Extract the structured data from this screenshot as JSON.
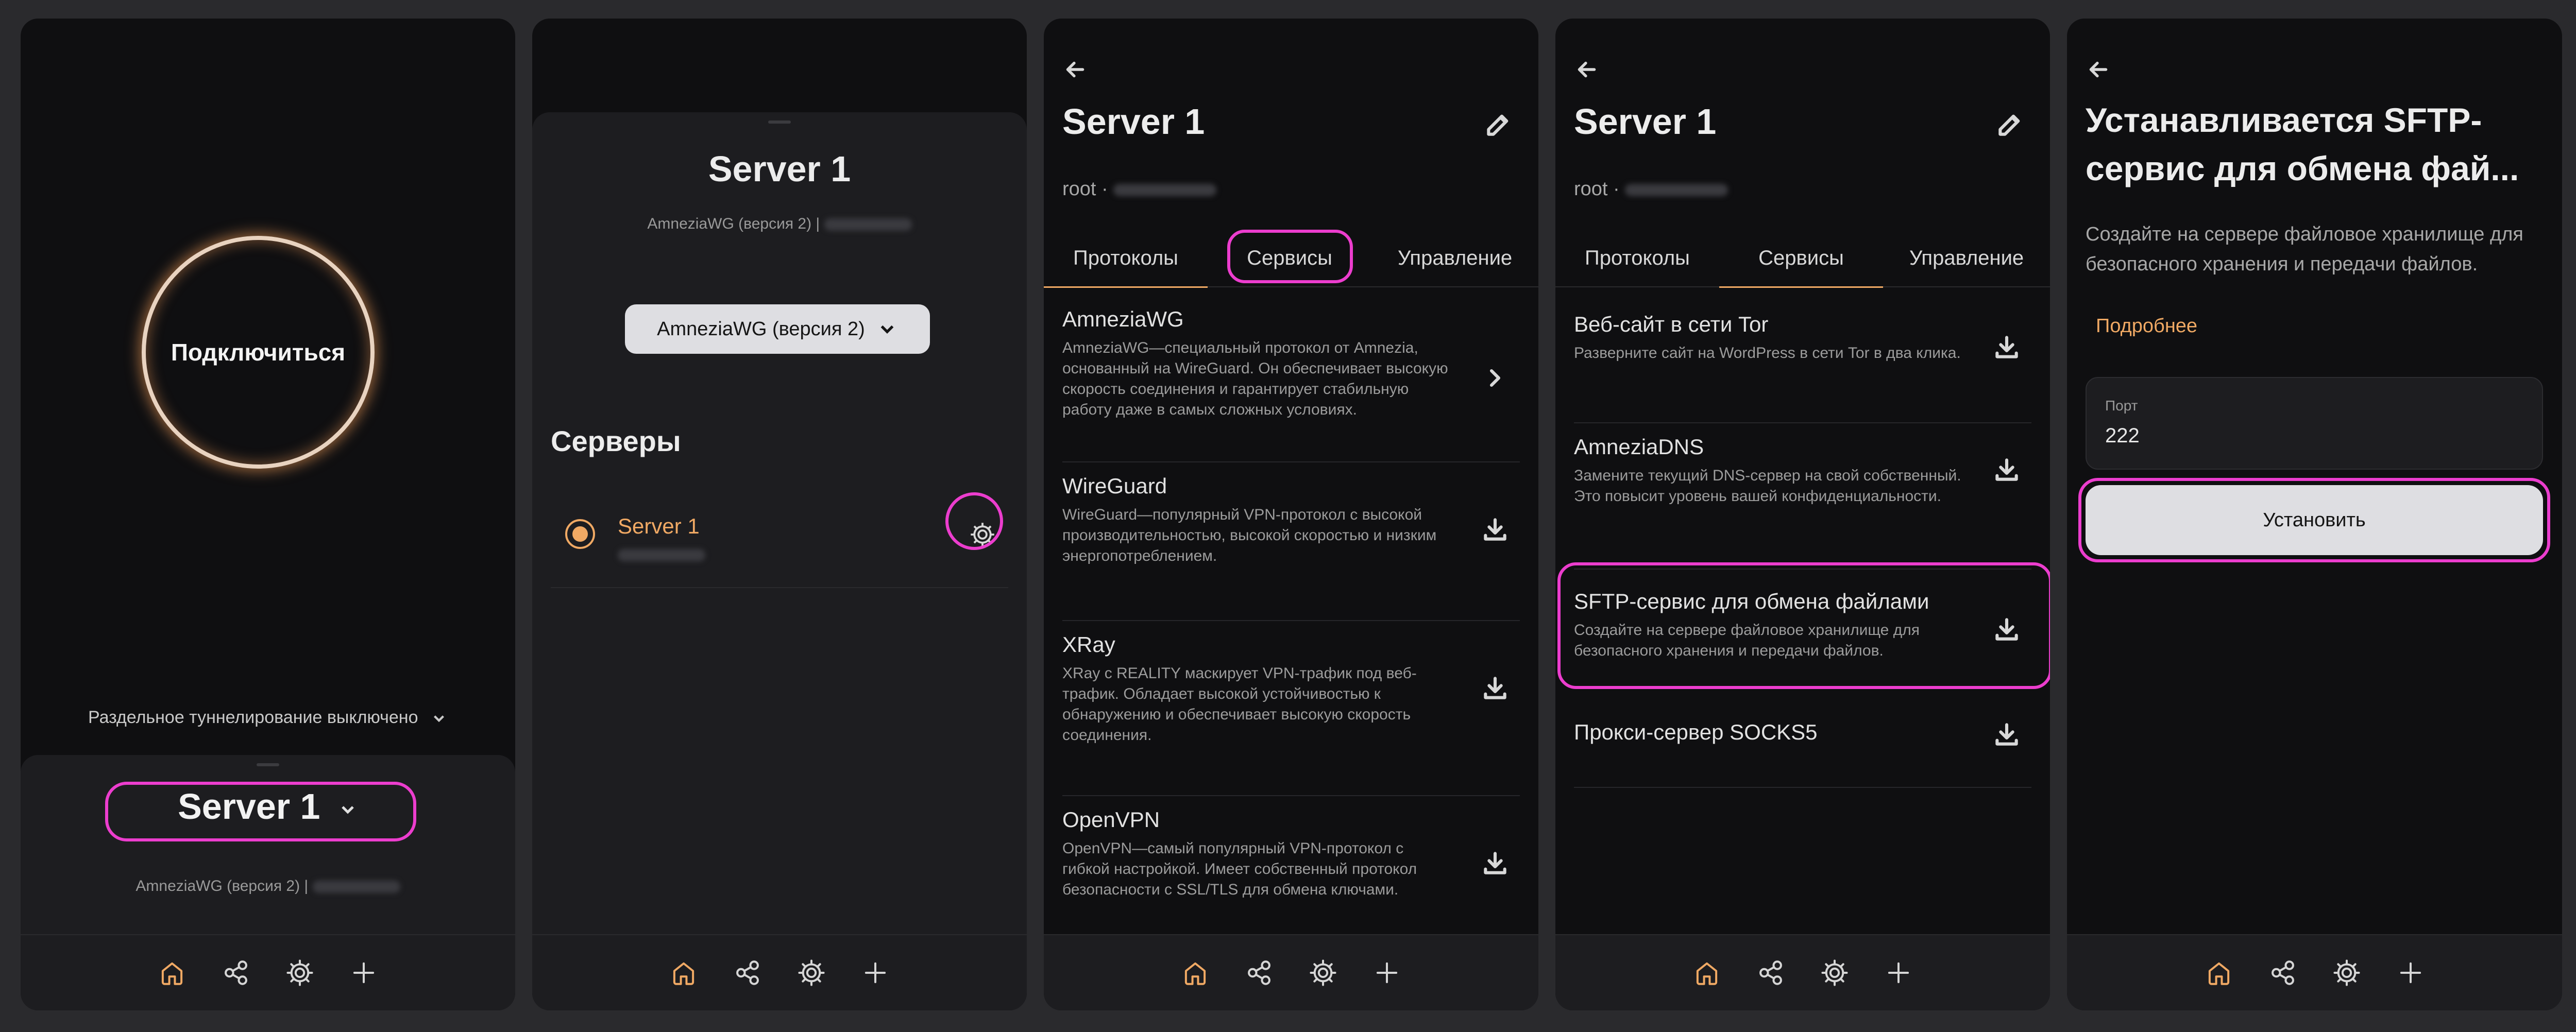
{
  "screen1": {
    "connect_label": "Подключиться",
    "split_tunneling": "Раздельное туннелирование выключено",
    "server_name": "Server 1",
    "protocol_line": "AmneziaWG (версия 2) |"
  },
  "screen2": {
    "server_title": "Server 1",
    "protocol_line": "AmneziaWG (версия 2) |",
    "protocol_select": "AmneziaWG (версия 2)",
    "servers_heading": "Серверы",
    "server_item": "Server 1"
  },
  "screen3": {
    "title": "Server 1",
    "user_prefix": "root ·",
    "tabs": [
      "Протоколы",
      "Сервисы",
      "Управление"
    ],
    "protocols": [
      {
        "name": "AmneziaWG",
        "desc": "AmneziaWG—специальный протокол от Amnezia, основанный на WireGuard. Он обеспечивает высокую скорость соединения и гарантирует стабильную работу даже в самых сложных условиях."
      },
      {
        "name": "WireGuard",
        "desc": "WireGuard—популярный VPN-протокол с высокой производительностью, высокой скоростью и низким энергопотреблением."
      },
      {
        "name": "XRay",
        "desc": "XRay с REALITY маскирует VPN-трафик под веб-трафик. Обладает высокой устойчивостью к обнаружению и обеспечивает высокую скорость соединения."
      },
      {
        "name": "OpenVPN",
        "desc": "OpenVPN—самый популярный VPN-протокол с гибкой настройкой. Имеет собственный протокол безопасности с SSL/TLS для обмена ключами."
      }
    ]
  },
  "screen4": {
    "title": "Server 1",
    "user_prefix": "root ·",
    "tabs": [
      "Протоколы",
      "Сервисы",
      "Управление"
    ],
    "services": [
      {
        "name": "Веб-сайт в сети Tor",
        "desc": "Разверните сайт на WordPress в сети Tor в два клика."
      },
      {
        "name": "AmneziaDNS",
        "desc": "Замените текущий DNS-сервер на свой собственный. Это повысит уровень вашей конфиденциальности."
      },
      {
        "name": "SFTP-сервис для обмена файлами",
        "desc": "Создайте на сервере файловое хранилище для безопасного хранения и передачи файлов."
      },
      {
        "name": "Прокси-сервер SOCKS5",
        "desc": ""
      }
    ]
  },
  "screen5": {
    "title_line1": "Устанавливается SFTP-",
    "title_line2": "сервис для обмена фай...",
    "description": "Создайте на сервере файловое хранилище для безопасного хранения и передачи файлов.",
    "more_link": "Подробнее",
    "port_label": "Порт",
    "port_value": "222",
    "install_button": "Установить"
  },
  "colors": {
    "accent": "#f0a964",
    "highlight": "#ec3dce",
    "background": "#0f0f11",
    "panel": "#1d1d20"
  },
  "icons": [
    "home-icon",
    "share-icon",
    "gear-icon",
    "plus-icon",
    "back-arrow-icon",
    "edit-icon",
    "chevron-right-icon",
    "download-icon",
    "chevron-down-icon"
  ]
}
